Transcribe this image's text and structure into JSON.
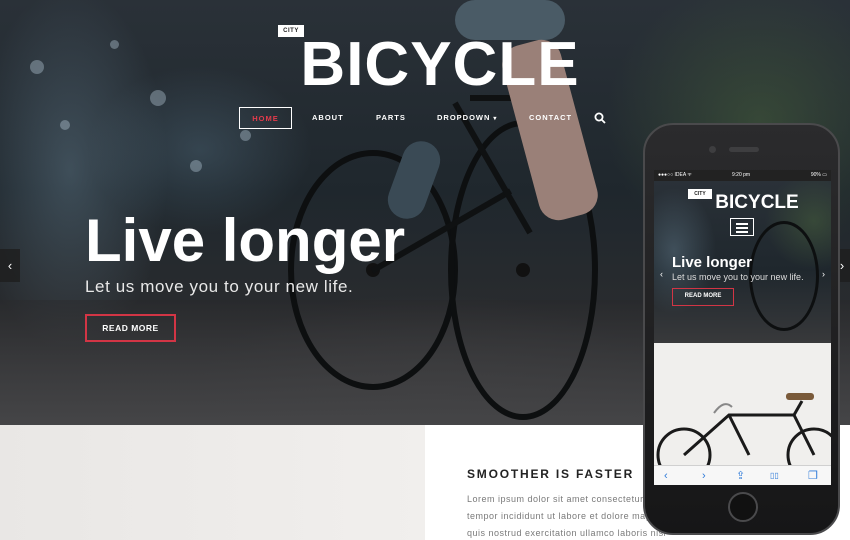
{
  "header": {
    "badge": "CITY",
    "logo": "BICYCLE",
    "nav": [
      {
        "label": "HOME",
        "active": true
      },
      {
        "label": "ABOUT"
      },
      {
        "label": "PARTS"
      },
      {
        "label": "DROPDOWN",
        "caret": "▾"
      },
      {
        "label": "CONTACT"
      }
    ],
    "search_icon": "search-icon"
  },
  "hero": {
    "headline": "Live longer",
    "subline": "Let us move you to your new life.",
    "button": "READ MORE",
    "prev_arrow": "‹",
    "next_arrow": "›"
  },
  "feature": {
    "heading": "SMOOTHER IS FASTER",
    "lines": [
      "Lorem ipsum dolor sit amet consectetur adipiscing elit",
      "tempor incididunt ut labore et dolore magna aliqua",
      "quis nostrud exercitation ullamco laboris nisi"
    ]
  },
  "phone": {
    "status": {
      "carrier": "●●●○○ IDEA ᯤ",
      "time": "9:20 pm",
      "battery": "90% ▭"
    },
    "badge": "CITY",
    "logo": "BICYCLE",
    "headline": "Live longer",
    "subline": "Let us move you to your new life.",
    "button": "READ MORE",
    "prev_arrow": "‹",
    "next_arrow": "›",
    "toolbar": {
      "back": "‹",
      "forward": "›",
      "share": "⇪",
      "bookmarks": "▯▯",
      "tabs": "❐"
    }
  },
  "colors": {
    "accent": "#d23545",
    "hero_bg": "#1f272d",
    "text_light": "#ffffff"
  }
}
